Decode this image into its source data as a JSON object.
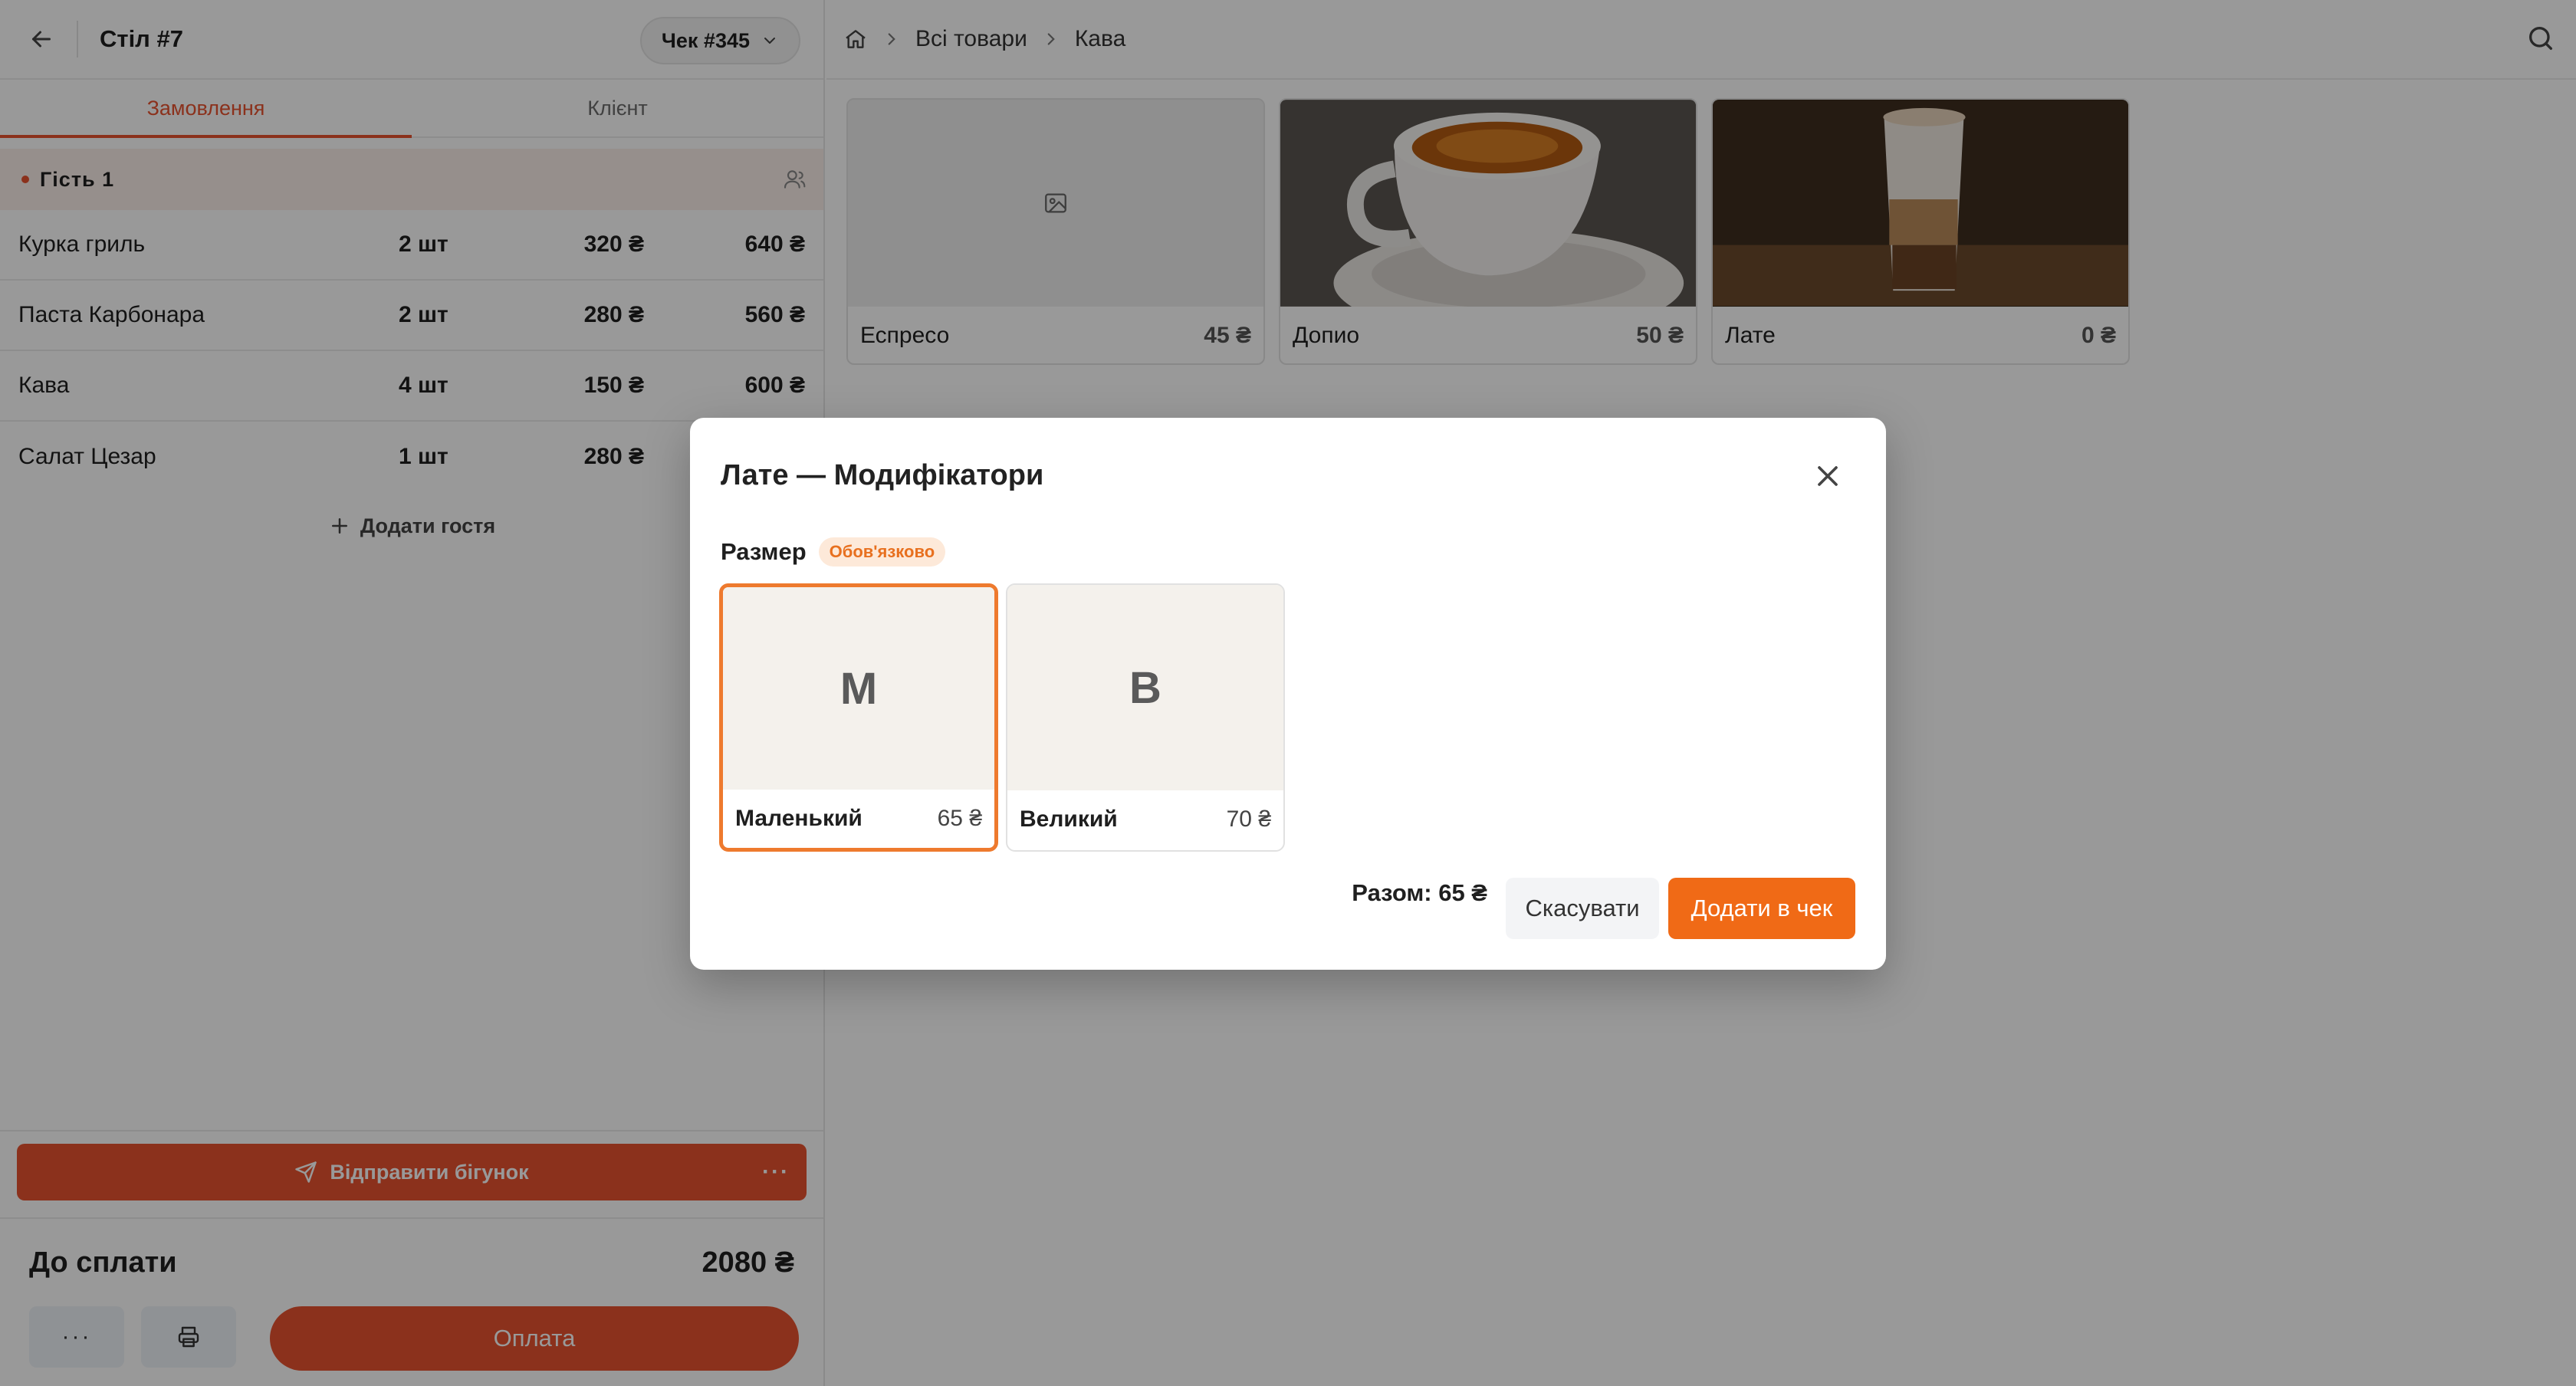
{
  "left": {
    "back_icon": "arrow-left-icon",
    "table_title": "Стіл #7",
    "check_label": "Чек #345",
    "tabs": [
      {
        "label": "Замовлення",
        "active": true
      },
      {
        "label": "Клієнт",
        "active": false
      }
    ],
    "guest": {
      "name": "Гість 1"
    },
    "items": [
      {
        "name": "Курка гриль",
        "qty": "2 шт",
        "price": "320 ₴",
        "total": "640 ₴"
      },
      {
        "name": "Паста Карбонара",
        "qty": "2 шт",
        "price": "280 ₴",
        "total": "560 ₴"
      },
      {
        "name": "Кава",
        "qty": "4 шт",
        "price": "150 ₴",
        "total": "600 ₴"
      },
      {
        "name": "Салат Цезар",
        "qty": "1 шт",
        "price": "280 ₴",
        "total": ""
      }
    ],
    "add_guest_label": "Додати гостя",
    "send_label": "Відправити бігунок",
    "more_label": "···",
    "due_label": "До сплати",
    "due_amount": "2080 ₴",
    "pay_label": "Оплата"
  },
  "breadcrumb": {
    "items": [
      "Всі товари",
      "Кава"
    ]
  },
  "products": [
    {
      "name": "Еспресо",
      "price": "45 ₴",
      "image": "placeholder"
    },
    {
      "name": "Допио",
      "price": "50 ₴",
      "image": "espresso-cup"
    },
    {
      "name": "Лате",
      "price": "0 ₴",
      "image": "latte-glass"
    }
  ],
  "modal": {
    "title": "Лате — Модифікатори",
    "group_label": "Размер",
    "required_label": "Обов'язково",
    "options": [
      {
        "letter": "М",
        "name": "Маленький",
        "price": "65 ₴",
        "selected": true
      },
      {
        "letter": "В",
        "name": "Великий",
        "price": "70 ₴",
        "selected": false
      }
    ],
    "total_label": "Разом: 65 ₴",
    "cancel_label": "Скасувати",
    "add_label": "Додати в чек"
  },
  "colors": {
    "accent": "#e8532f",
    "modal_accent": "#f06a16"
  }
}
